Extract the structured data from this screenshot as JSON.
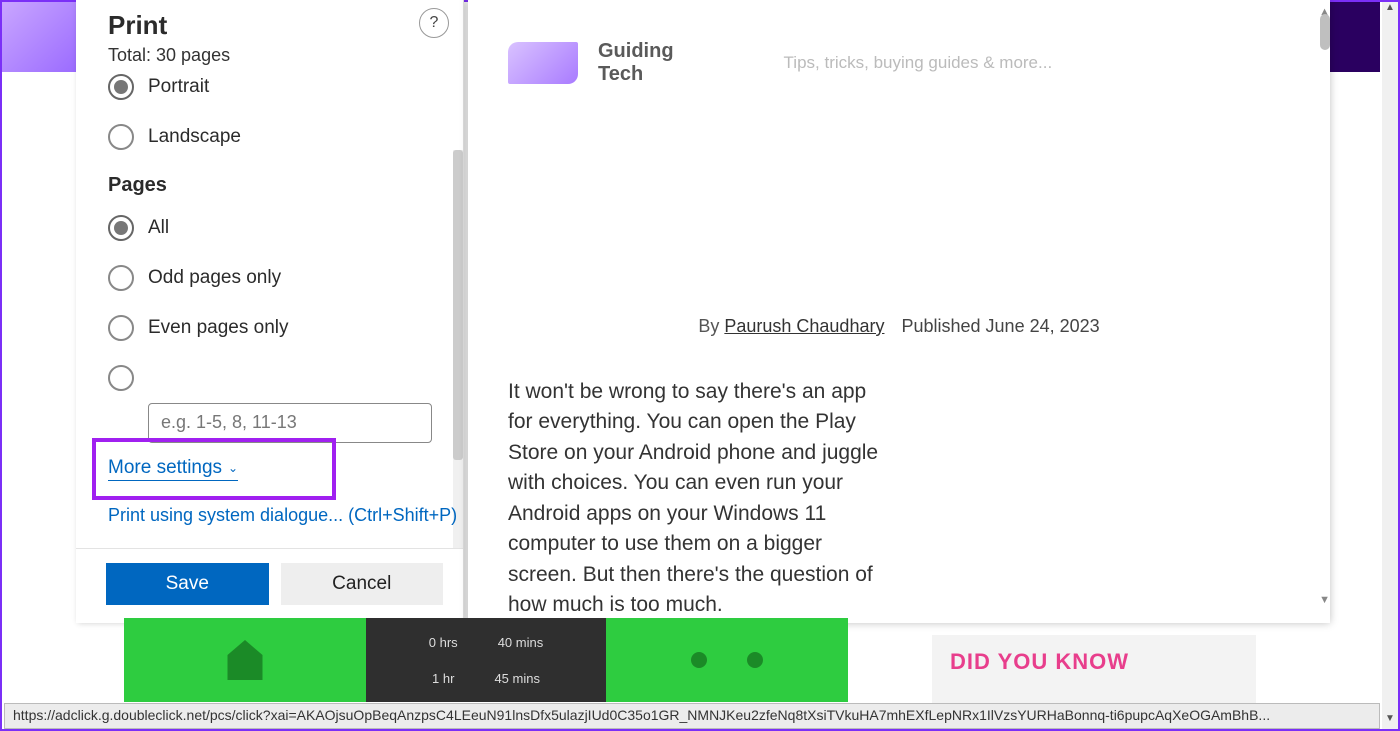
{
  "print": {
    "title": "Print",
    "total": "Total: 30 pages",
    "help_icon": "?",
    "orientation": {
      "portrait": "Portrait",
      "landscape": "Landscape"
    },
    "pages_header": "Pages",
    "pages": {
      "all": "All",
      "odd": "Odd pages only",
      "even": "Even pages only",
      "range_placeholder": "e.g. 1-5, 8, 11-13"
    },
    "more_settings": "More settings",
    "system_dialog": "Print using system dialogue... (Ctrl+Shift+P)",
    "save": "Save",
    "cancel": "Cancel"
  },
  "preview": {
    "site_name_l1": "Guiding",
    "site_name_l2": "Tech",
    "tagline": "Tips, tricks, buying guides & more...",
    "by_label": "By ",
    "author": "Paurush Chaudhary",
    "published": "Published June 24, 2023",
    "body": "It won't be wrong to say there's an app for everything. You can open the Play Store on your Android phone and juggle with choices. You can even run your Android apps on your Windows 11 computer to use them on a bigger screen. But then there's the question of how much is too much."
  },
  "background": {
    "time_r1c1": "0 hrs",
    "time_r1c2": "40 mins",
    "time_r2c1": "1 hr",
    "time_r2c2": "45 mins",
    "dyk": "DID YOU KNOW"
  },
  "status_url": "https://adclick.g.doubleclick.net/pcs/click?xai=AKAOjsuOpBeqAnzpsC4LEeuN91lnsDfx5ulazjIUd0C35o1GR_NMNJKeu2zfeNq8tXsiTVkuHA7mhEXfLepNRx1IlVzsYURHaBonnq-ti6pupcAqXeOGAmBhB..."
}
